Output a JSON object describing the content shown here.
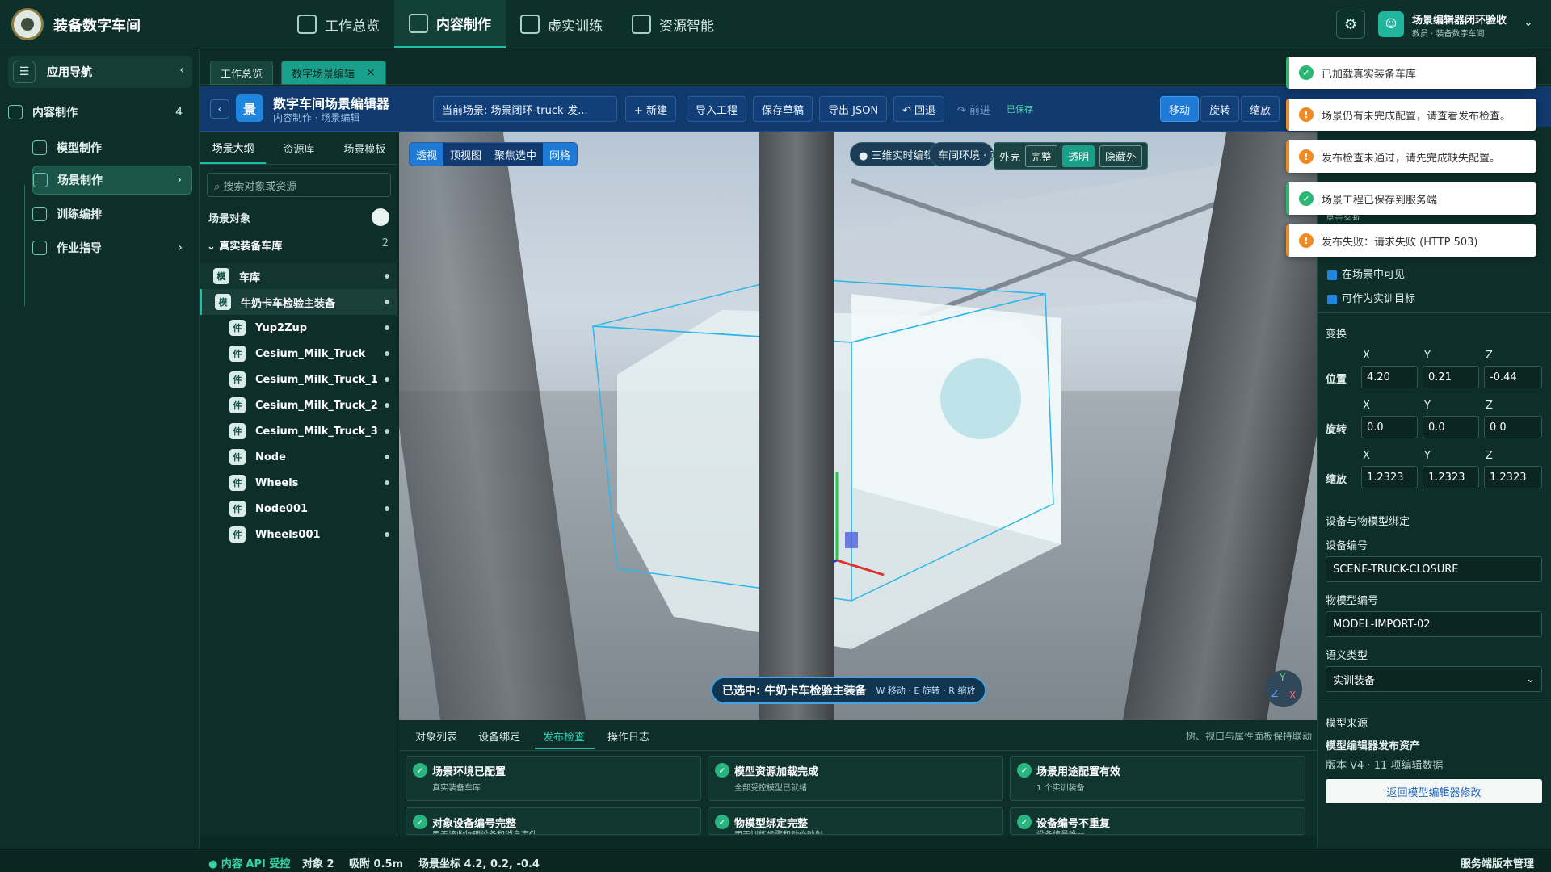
{
  "app": {
    "title": "装备数字车间"
  },
  "nav_tabs": [
    {
      "label": "工作总览"
    },
    {
      "label": "内容制作"
    },
    {
      "label": "虚实训练"
    },
    {
      "label": "资源智能"
    }
  ],
  "user": {
    "name": "场景编辑器闭环验收",
    "role": "教员 · 装备数字车间"
  },
  "sidebar": {
    "title": "应用导航",
    "items": [
      {
        "label": "内容制作",
        "count": "4"
      },
      {
        "label": "模型制作"
      },
      {
        "label": "场景制作"
      },
      {
        "label": "训练编排"
      },
      {
        "label": "作业指导"
      }
    ]
  },
  "workspace_tabs": [
    {
      "label": "工作总览"
    },
    {
      "label": "数字场景编辑"
    }
  ],
  "editor": {
    "icon_char": "景",
    "title": "数字车间场景编辑器",
    "breadcrumb": "内容制作 · 场景编辑",
    "current_scene": "当前场景:  场景闭环-truck-发...",
    "buttons": {
      "new": "+ 新建",
      "import": "导入工程",
      "save_draft": "保存草稿",
      "export": "导出 JSON",
      "undo": "↶ 回退",
      "redo": "↷ 前进"
    },
    "saved_badge": "已保存",
    "modes": [
      "移动",
      "旋转",
      "缩放"
    ]
  },
  "left_panel": {
    "tabs": [
      "场景大纲",
      "资源库",
      "场景模板"
    ],
    "search_placeholder": "⌕ 搜索对象或资源",
    "section": "场景对象",
    "group": {
      "label": "⌄ 真实装备车库",
      "count": "2"
    },
    "nodes": [
      {
        "badge": "模",
        "label": "车库"
      },
      {
        "badge": "模",
        "label": "牛奶卡车检验主装备"
      },
      {
        "badge": "件",
        "label": "Yup2Zup"
      },
      {
        "badge": "件",
        "label": "Cesium_Milk_Truck"
      },
      {
        "badge": "件",
        "label": "Cesium_Milk_Truck_1"
      },
      {
        "badge": "件",
        "label": "Cesium_Milk_Truck_2"
      },
      {
        "badge": "件",
        "label": "Cesium_Milk_Truck_3"
      },
      {
        "badge": "件",
        "label": "Node"
      },
      {
        "badge": "件",
        "label": "Wheels"
      },
      {
        "badge": "件",
        "label": "Node001"
      },
      {
        "badge": "件",
        "label": "Wheels001"
      }
    ]
  },
  "viewport": {
    "view_modes": [
      "透视",
      "顶视图",
      "聚焦选中",
      "网格"
    ],
    "chip_realtime": "● 三维实时编辑",
    "chip_env": "车间环境 · 正",
    "overlay": {
      "label": "外壳",
      "full": "完整",
      "transparent": "透明",
      "hide": "隐藏外"
    },
    "selection": "已选中:  牛奶卡车检验主装备",
    "selection_hint": "W 移动 · E 旋转 · R 缩放",
    "gizmo": {
      "y": "Y",
      "z": "Z",
      "x": "X"
    }
  },
  "bottom_panel": {
    "tabs": [
      "对象列表",
      "设备绑定",
      "发布检查",
      "操作日志"
    ],
    "note": "树、视口与属性面板保持联动",
    "checks": [
      {
        "title": "场景环境已配置",
        "sub": "真实装备车库"
      },
      {
        "title": "模型资源加载完成",
        "sub": "全部受控模型已就绪"
      },
      {
        "title": "场景用途配置有效",
        "sub": "1 个实训装备"
      },
      {
        "title": "对象设备编号完整",
        "sub": "用于接收物理设备和消息事件"
      },
      {
        "title": "物模型绑定完整",
        "sub": "用于训练步骤和动作映射"
      },
      {
        "title": "设备编号不重复",
        "sub": "设备编号唯一"
      }
    ]
  },
  "status_bar": {
    "api": "● 内容 API 受控",
    "objects": "对象 2",
    "snap": "吸附 0.5m",
    "coords": "场景坐标 4.2, 0.2, -0.4",
    "right": "服务端版本管理"
  },
  "right_panel": {
    "partial_label": "显示名称",
    "visible": "在场景中可见",
    "target": "可作为实训目标",
    "transform_title": "变换",
    "axes": [
      "X",
      "Y",
      "Z"
    ],
    "position_label": "位置",
    "position": [
      "4.20",
      "0.21",
      "-0.44"
    ],
    "rotation_label": "旋转",
    "rotation": [
      "0.0",
      "0.0",
      "0.0"
    ],
    "scale_label": "缩放",
    "scale": [
      "1.2323",
      "1.2323",
      "1.2323"
    ],
    "binding_title": "设备与物模型绑定",
    "device_id_label": "设备编号",
    "device_id": "SCENE-TRUCK-CLOSURE",
    "model_id_label": "物模型编号",
    "model_id": "MODEL-IMPORT-02",
    "semantic_label": "语义类型",
    "semantic_value": "实训装备",
    "source_title": "模型来源",
    "source_name": "模型编辑器发布资产",
    "source_version": "版本 V4 · 11 项编辑数据",
    "back_button": "返回模型编辑器修改"
  },
  "toasts": [
    {
      "type": "ok",
      "text": "已加载真实装备车库"
    },
    {
      "type": "warn",
      "text": "场景仍有未完成配置，请查看发布检查。"
    },
    {
      "type": "warn",
      "text": "发布检查未通过，请先完成缺失配置。"
    },
    {
      "type": "ok",
      "text": "场景工程已保存到服务端"
    },
    {
      "type": "warn",
      "text": "发布失败：请求失败 (HTTP 503)"
    }
  ],
  "colors": {
    "accent": "#1fbfa6",
    "primary": "#1f7ad6",
    "ok": "#2bb673",
    "warn": "#f08a24"
  }
}
